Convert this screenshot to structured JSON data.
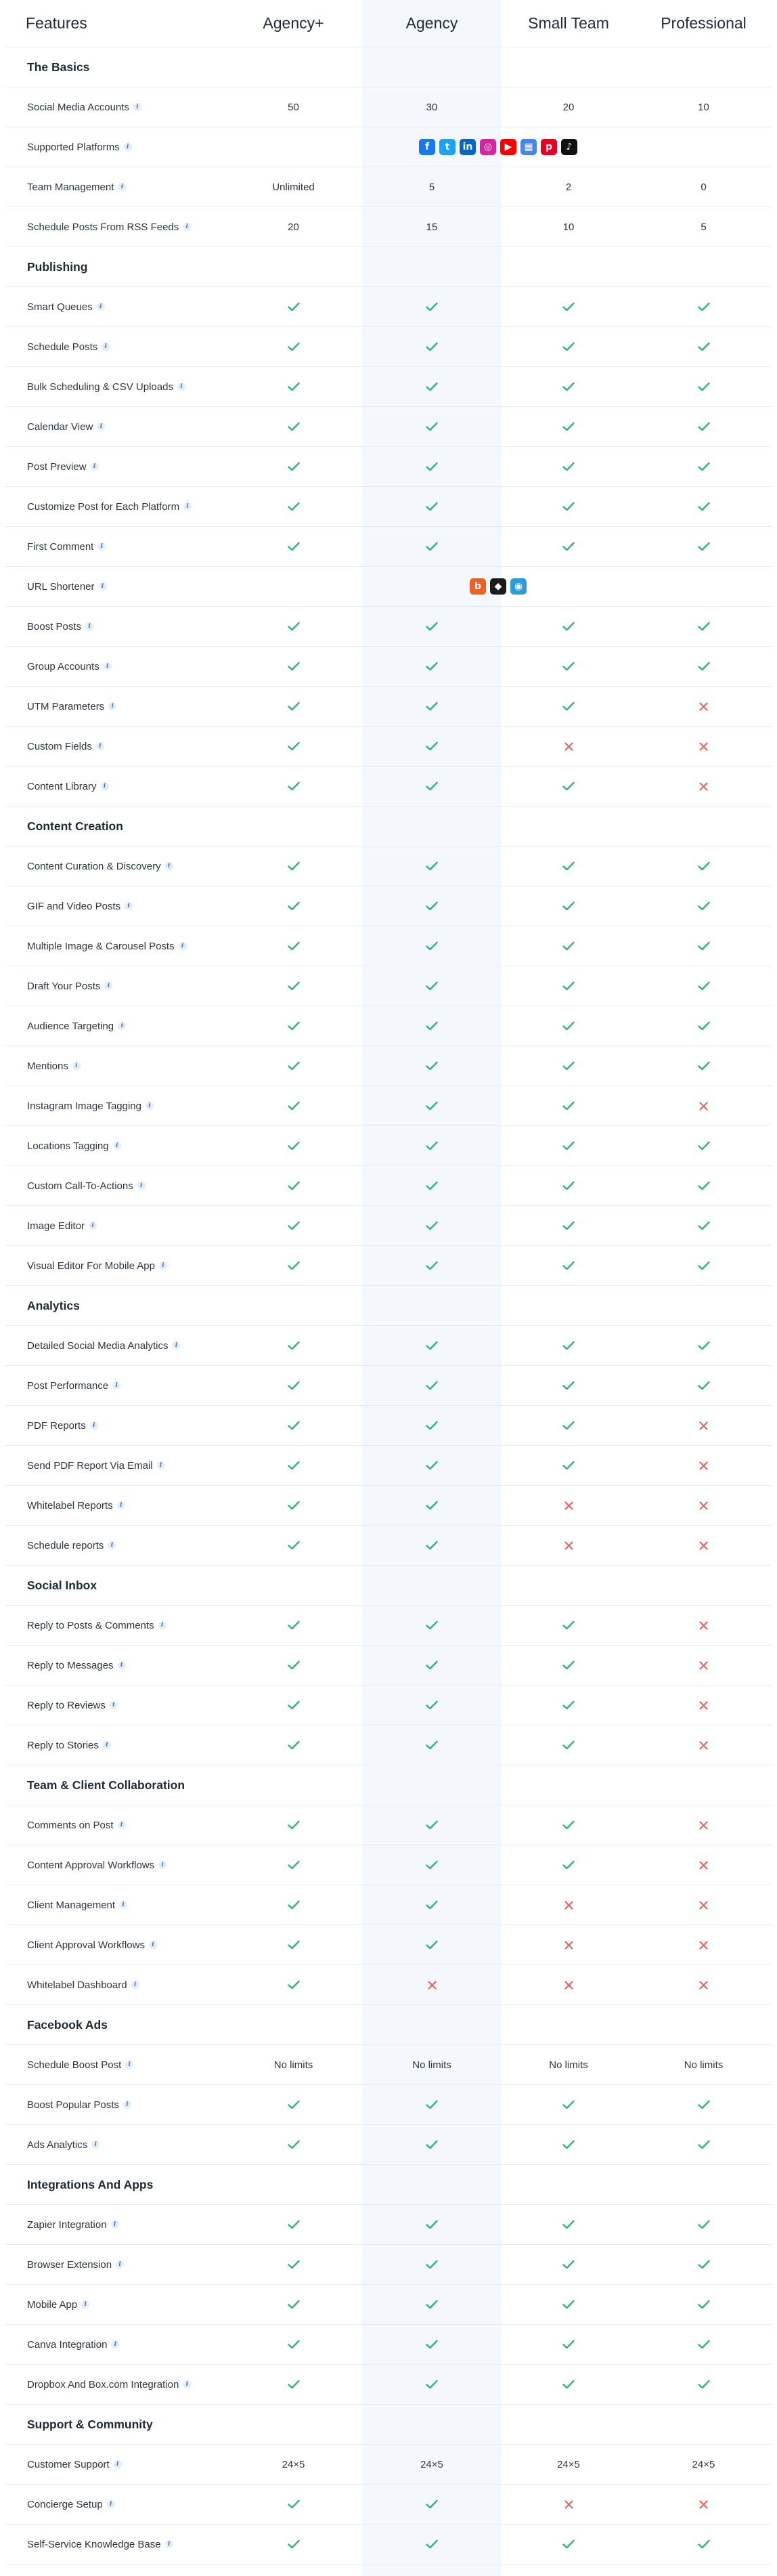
{
  "colors": {
    "check": "#2bb673",
    "cross": "#f0625b",
    "agency_band": "#f4f8fd",
    "info": "#3a78d4"
  },
  "header": {
    "features": "Features",
    "plans": [
      "Agency+",
      "Agency",
      "Small Team",
      "Professional"
    ]
  },
  "sections": [
    {
      "title": "The Basics",
      "rows": [
        {
          "name": "Social Media Accounts",
          "values": [
            "50",
            "30",
            "20",
            "10"
          ]
        },
        {
          "name": "Supported Platforms",
          "icons": [
            {
              "icon": "facebook-icon",
              "glyph": "f",
              "bg": "#1877f2",
              "round": false
            },
            {
              "icon": "twitter-icon",
              "glyph": "t",
              "bg": "#1da1f2",
              "round": false
            },
            {
              "icon": "linkedin-icon",
              "glyph": "in",
              "bg": "#0a66c2",
              "round": false
            },
            {
              "icon": "instagram-icon",
              "glyph": "◎",
              "bg": "#d6249f",
              "round": false
            },
            {
              "icon": "youtube-icon",
              "glyph": "▶",
              "bg": "#ff0000",
              "round": false
            },
            {
              "icon": "google-business-icon",
              "glyph": "▦",
              "bg": "#4285f4",
              "round": false
            },
            {
              "icon": "pinterest-icon",
              "glyph": "p",
              "bg": "#e60023",
              "round": false
            },
            {
              "icon": "tiktok-icon",
              "glyph": "♪",
              "bg": "#111111",
              "round": false
            }
          ]
        },
        {
          "name": "Team Management",
          "values": [
            "Unlimited",
            "5",
            "2",
            "0"
          ]
        },
        {
          "name": "Schedule Posts From RSS Feeds",
          "values": [
            "20",
            "15",
            "10",
            "5"
          ]
        }
      ]
    },
    {
      "title": "Publishing",
      "rows": [
        {
          "name": "Smart Queues",
          "values": [
            "check",
            "check",
            "check",
            "check"
          ]
        },
        {
          "name": "Schedule Posts",
          "values": [
            "check",
            "check",
            "check",
            "check"
          ]
        },
        {
          "name": "Bulk Scheduling & CSV Uploads",
          "values": [
            "check",
            "check",
            "check",
            "check"
          ]
        },
        {
          "name": "Calendar View",
          "values": [
            "check",
            "check",
            "check",
            "check"
          ]
        },
        {
          "name": "Post Preview",
          "values": [
            "check",
            "check",
            "check",
            "check"
          ]
        },
        {
          "name": "Customize Post for Each Platform",
          "values": [
            "check",
            "check",
            "check",
            "check"
          ]
        },
        {
          "name": "First Comment",
          "values": [
            "check",
            "check",
            "check",
            "check"
          ]
        },
        {
          "name": "URL Shortener",
          "icons": [
            {
              "icon": "bitly-icon",
              "glyph": "b",
              "bg": "#ee6123",
              "round": false
            },
            {
              "icon": "rebrandly-icon",
              "glyph": "◆",
              "bg": "#1b1b1b",
              "round": false
            },
            {
              "icon": "shortio-icon",
              "glyph": "◉",
              "bg": "#2d9cdb",
              "round": false
            }
          ]
        },
        {
          "name": "Boost Posts",
          "values": [
            "check",
            "check",
            "check",
            "check"
          ]
        },
        {
          "name": "Group Accounts",
          "values": [
            "check",
            "check",
            "check",
            "check"
          ]
        },
        {
          "name": "UTM Parameters",
          "values": [
            "check",
            "check",
            "check",
            "cross"
          ]
        },
        {
          "name": "Custom Fields",
          "values": [
            "check",
            "check",
            "cross",
            "cross"
          ]
        },
        {
          "name": "Content Library",
          "values": [
            "check",
            "check",
            "check",
            "cross"
          ]
        }
      ]
    },
    {
      "title": "Content Creation",
      "rows": [
        {
          "name": "Content Curation & Discovery",
          "values": [
            "check",
            "check",
            "check",
            "check"
          ]
        },
        {
          "name": "GIF and Video Posts",
          "values": [
            "check",
            "check",
            "check",
            "check"
          ]
        },
        {
          "name": "Multiple Image & Carousel Posts",
          "values": [
            "check",
            "check",
            "check",
            "check"
          ]
        },
        {
          "name": "Draft Your Posts",
          "values": [
            "check",
            "check",
            "check",
            "check"
          ]
        },
        {
          "name": "Audience Targeting",
          "values": [
            "check",
            "check",
            "check",
            "check"
          ]
        },
        {
          "name": "Mentions",
          "values": [
            "check",
            "check",
            "check",
            "check"
          ]
        },
        {
          "name": "Instagram Image Tagging",
          "values": [
            "check",
            "check",
            "check",
            "cross"
          ]
        },
        {
          "name": "Locations Tagging",
          "values": [
            "check",
            "check",
            "check",
            "check"
          ]
        },
        {
          "name": "Custom Call-To-Actions",
          "values": [
            "check",
            "check",
            "check",
            "check"
          ]
        },
        {
          "name": "Image Editor",
          "values": [
            "check",
            "check",
            "check",
            "check"
          ]
        },
        {
          "name": "Visual Editor For Mobile App",
          "values": [
            "check",
            "check",
            "check",
            "check"
          ]
        }
      ]
    },
    {
      "title": "Analytics",
      "rows": [
        {
          "name": "Detailed Social Media Analytics",
          "values": [
            "check",
            "check",
            "check",
            "check"
          ]
        },
        {
          "name": "Post Performance",
          "values": [
            "check",
            "check",
            "check",
            "check"
          ]
        },
        {
          "name": "PDF Reports",
          "values": [
            "check",
            "check",
            "check",
            "cross"
          ]
        },
        {
          "name": "Send PDF Report Via Email",
          "values": [
            "check",
            "check",
            "check",
            "cross"
          ]
        },
        {
          "name": "Whitelabel Reports",
          "values": [
            "check",
            "check",
            "cross",
            "cross"
          ]
        },
        {
          "name": "Schedule reports",
          "values": [
            "check",
            "check",
            "cross",
            "cross"
          ]
        }
      ]
    },
    {
      "title": "Social Inbox",
      "rows": [
        {
          "name": "Reply to Posts & Comments",
          "values": [
            "check",
            "check",
            "check",
            "cross"
          ]
        },
        {
          "name": "Reply to Messages",
          "values": [
            "check",
            "check",
            "check",
            "cross"
          ]
        },
        {
          "name": "Reply to Reviews",
          "values": [
            "check",
            "check",
            "check",
            "cross"
          ]
        },
        {
          "name": "Reply to Stories",
          "values": [
            "check",
            "check",
            "check",
            "cross"
          ]
        }
      ]
    },
    {
      "title": "Team & Client Collaboration",
      "rows": [
        {
          "name": "Comments on Post",
          "values": [
            "check",
            "check",
            "check",
            "cross"
          ]
        },
        {
          "name": "Content Approval Workflows",
          "values": [
            "check",
            "check",
            "check",
            "cross"
          ]
        },
        {
          "name": "Client Management",
          "values": [
            "check",
            "check",
            "cross",
            "cross"
          ]
        },
        {
          "name": "Client Approval Workflows",
          "values": [
            "check",
            "check",
            "cross",
            "cross"
          ]
        },
        {
          "name": "Whitelabel Dashboard",
          "values": [
            "check",
            "cross",
            "cross",
            "cross"
          ]
        }
      ]
    },
    {
      "title": "Facebook Ads",
      "rows": [
        {
          "name": "Schedule Boost Post",
          "values": [
            "No limits",
            "No limits",
            "No limits",
            "No limits"
          ]
        },
        {
          "name": "Boost Popular Posts",
          "values": [
            "check",
            "check",
            "check",
            "check"
          ]
        },
        {
          "name": "Ads Analytics",
          "values": [
            "check",
            "check",
            "check",
            "check"
          ]
        }
      ]
    },
    {
      "title": "Integrations And Apps",
      "rows": [
        {
          "name": "Zapier Integration",
          "values": [
            "check",
            "check",
            "check",
            "check"
          ]
        },
        {
          "name": "Browser Extension",
          "values": [
            "check",
            "check",
            "check",
            "check"
          ]
        },
        {
          "name": "Mobile App",
          "values": [
            "check",
            "check",
            "check",
            "check"
          ]
        },
        {
          "name": "Canva Integration",
          "values": [
            "check",
            "check",
            "check",
            "check"
          ]
        },
        {
          "name": "Dropbox And Box.com Integration",
          "values": [
            "check",
            "check",
            "check",
            "check"
          ]
        }
      ]
    },
    {
      "title": "Support & Community",
      "rows": [
        {
          "name": "Customer Support",
          "values": [
            "24×5",
            "24×5",
            "24×5",
            "24×5"
          ]
        },
        {
          "name": "Concierge Setup",
          "values": [
            "check",
            "check",
            "cross",
            "cross"
          ]
        },
        {
          "name": "Self-Service Knowledge Base",
          "values": [
            "check",
            "check",
            "check",
            "check"
          ]
        }
      ]
    }
  ]
}
